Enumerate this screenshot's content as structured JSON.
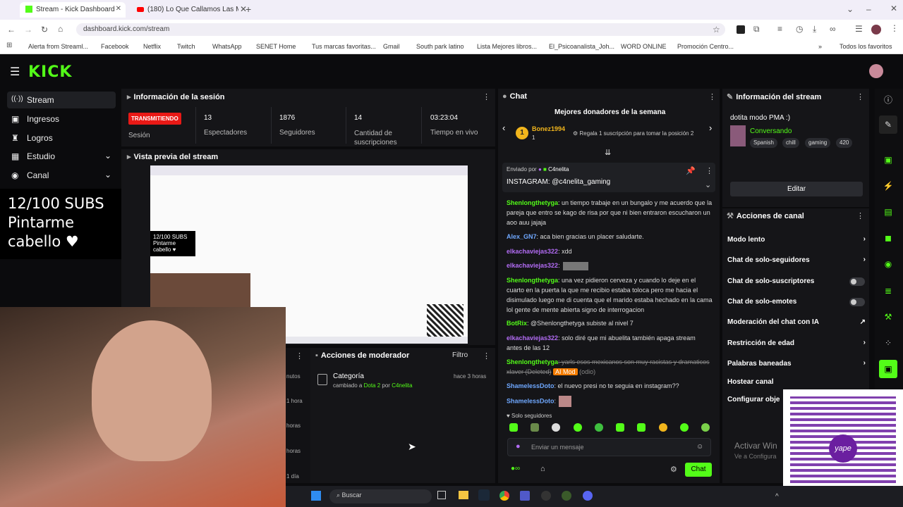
{
  "browser": {
    "tabs": [
      {
        "title": "Stream - Kick Dashboard",
        "active": true
      },
      {
        "title": "(180) Lo Que Callamos Las Muj",
        "active": false
      }
    ],
    "url": "dashboard.kick.com/stream",
    "bookmarks": [
      "Alerta from Streaml...",
      "Facebook",
      "Netflix",
      "Twitch",
      "WhatsApp",
      "SENET Home",
      "Tus marcas favoritas...",
      "Gmail",
      "South park latino",
      "Lista Mejores libros...",
      "El_Psicoanalista_Joh...",
      "WORD ONLINE",
      "Promoción Centro..."
    ],
    "all_bookmarks": "Todos los favoritos"
  },
  "kick": {
    "logo": "KICK",
    "sidebar": [
      {
        "label": "Stream",
        "selected": true
      },
      {
        "label": "Ingresos"
      },
      {
        "label": "Logros"
      },
      {
        "label": "Estudio"
      },
      {
        "label": "Canal"
      }
    ],
    "overlay_text": "12/100 SUBS\nPintarme\ncabello ♥",
    "session": {
      "title": "Información de la sesión",
      "status": "TRANSMITIENDO",
      "status_label": "Sesión",
      "stats": [
        {
          "value": "13",
          "label": "Espectadores"
        },
        {
          "value": "1876",
          "label": "Seguidores"
        },
        {
          "value": "14",
          "label": "Cantidad de\nsuscripciones"
        },
        {
          "value": "03:23:04",
          "label": "Tiempo en vivo"
        }
      ]
    },
    "preview": {
      "title": "Vista previa del stream",
      "mini_overlay": "12/100 SUBS\nPintarme\ncabello ♥"
    },
    "mod": {
      "title": "Acciones de moderador",
      "filter": "Filtro",
      "entry_title": "Categoría",
      "entry_detail_prefix": "cambiado a",
      "entry_game": "Dota 2",
      "entry_by": "por",
      "entry_user": "C4nelita",
      "entry_time": "hace 3 horas",
      "left_times": [
        "nutos",
        "1 hora",
        "horas",
        "horas",
        "1 día"
      ]
    },
    "chat": {
      "title": "Chat",
      "top_donors": "Mejores donadores de la semana",
      "donor_rank": "1",
      "donor_name": "Bonez1994",
      "donor_count": "1",
      "gift_text": "Regala 1 suscripción para tomar la posición 2",
      "pinned_by_prefix": "Enviado por",
      "pinned_user": "C4nelita",
      "pinned_message": "INSTAGRAM: @c4nelita_gaming",
      "messages": [
        {
          "user": "Shenlongthetyga",
          "cls": "user-g",
          "text": ": un tiempo trabaje en un bungalo y me acuerdo que la pareja que entro se kago de risa por que ni bien entraron escucharon un aoo auu jajaja"
        },
        {
          "user": "Alex_GN7",
          "cls": "user-b",
          "text": ": aca bien gracias un placer saludarte."
        },
        {
          "user": "elkachaviejas322",
          "cls": "user-p",
          "text": ": xdd"
        },
        {
          "user": "elkachaviejas322",
          "cls": "user-p",
          "text": ":"
        },
        {
          "user": "Shenlongthetyga",
          "cls": "user-g",
          "text": ": una vez pidieron cerveza y cuando lo deje en el cuarto en la puerta la que me recibio estaba toloca pero me hacia el disimulado luego me di cuenta que el marido estaba hechado en la cama lol gente de mente abierta signo de interrogacion"
        },
        {
          "user": "BotRix",
          "cls": "user-g",
          "text": ": @Shenlongthetyga subiste al nivel 7"
        },
        {
          "user": "elkachaviejas322",
          "cls": "user-p",
          "text": ": solo diré que mi abuelita también apaga stream antes de las 12"
        },
        {
          "user": "Shenlongthetyga",
          "cls": "user-g",
          "text": ": yarls esos mexicanos son muy racistas y dramaticos xlaver (Deleted)"
        },
        {
          "user": "ShamelessDoto",
          "cls": "user-b",
          "text": ": el nuevo presi no te seguia en instagram??"
        },
        {
          "user": "ShamelessDoto",
          "cls": "user-b",
          "text": ":"
        }
      ],
      "ai_mod": "AI Mod",
      "ai_reason": "(odio)",
      "followers_only": "Solo seguidores",
      "input_placeholder": "Enviar un mensaje",
      "send_label": "Chat"
    },
    "stream_info": {
      "title": "Información del stream",
      "stream_title": "dotita modo PMA :)",
      "category": "Conversando",
      "tags": [
        "Spanish",
        "chill",
        "gaming",
        "420"
      ],
      "edit_label": "Editar"
    },
    "channel_actions": {
      "title": "Acciones de canal",
      "items": [
        {
          "label": "Modo lento",
          "control": "chevron"
        },
        {
          "label": "Chat de solo-seguidores",
          "control": "chevron"
        },
        {
          "label": "Chat de solo-suscriptores",
          "control": "toggle"
        },
        {
          "label": "Chat de solo-emotes",
          "control": "toggle"
        },
        {
          "label": "Moderación del chat con IA",
          "control": "external"
        },
        {
          "label": "Restricción de edad",
          "control": "chevron"
        },
        {
          "label": "Palabras baneadas",
          "control": "chevron"
        },
        {
          "label": "Hostear canal",
          "control": "none"
        },
        {
          "label": "Configurar obje",
          "control": "none"
        }
      ]
    },
    "activate_windows": {
      "line1": "Activar Win",
      "line2": "Ve a Configura"
    },
    "taskbar_search": "Buscar"
  },
  "colors": {
    "accent": "#53fc18",
    "live": "#e91916",
    "panel": "#151518",
    "bg": "#0b0b0d"
  }
}
